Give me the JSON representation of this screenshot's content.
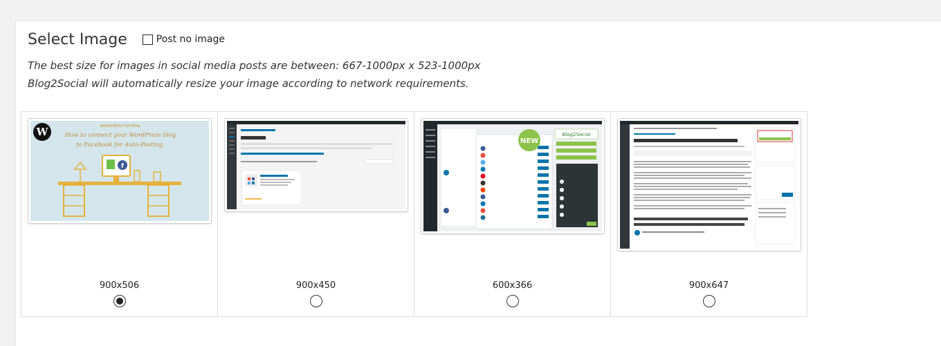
{
  "section": {
    "title": "Select Image",
    "post_no_image_label": "Post no image",
    "post_no_image_checked": false,
    "hint_line1": "The best size for images in social media posts are between: 667-1000px x 523-1000px",
    "hint_line2": "Blog2Social will automatically resize your image according to network requirements."
  },
  "images": [
    {
      "dimensions": "900x506",
      "selected": true,
      "content": "wordpress-tutorial-desk-illustration",
      "heading": "WORDPRESS TUTORIAL",
      "caption_line1": "How to connect your WordPress blog",
      "caption_line2": "to Facebook for Auto-Posting."
    },
    {
      "dimensions": "900x450",
      "selected": false,
      "content": "wordpress-add-plugins-screenshot"
    },
    {
      "dimensions": "600x366",
      "selected": false,
      "content": "blog2social-network-list-screenshot",
      "badge": "NEW",
      "brand": "Blog2Social"
    },
    {
      "dimensions": "900x647",
      "selected": false,
      "content": "blog-post-editor-screenshot"
    }
  ],
  "colors": {
    "panel_bg": "#ffffff",
    "page_bg": "#f1f1f1",
    "thumb1_bg": "#d4e6ec",
    "thumb1_accent": "#e3b13c",
    "wp_admin_bar": "#23282d",
    "new_badge": "#8bc34a",
    "link_blue": "#0073aa"
  }
}
